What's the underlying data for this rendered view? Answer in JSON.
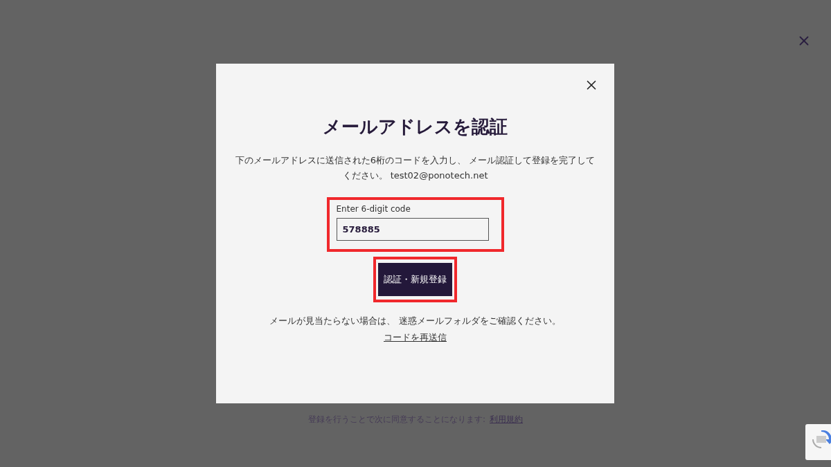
{
  "page": {
    "terms_text": "登録を行うことで次に同意することになります:",
    "terms_link": "利用規約"
  },
  "dialog": {
    "title": "メールアドレスを認証",
    "description": "下のメールアドレスに送信された6桁のコードを入力し、 メール認証して登録を完了してください。 test02@ponotech.net",
    "code_field": {
      "label": "Enter 6-digit code",
      "value": "578885",
      "highlighted": true
    },
    "submit_button": {
      "label": "認証・新規登録",
      "highlighted": true
    },
    "note": "メールが見当たらない場合は、 迷惑メールフォルダをご確認ください。",
    "resend_link": "コードを再送信"
  }
}
